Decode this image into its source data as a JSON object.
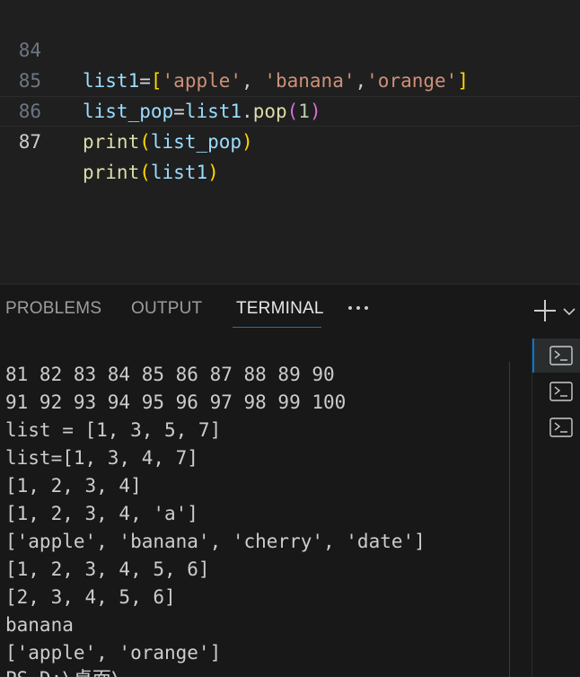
{
  "editor": {
    "lines": [
      {
        "number": "84",
        "tokens": [
          {
            "t": "list1",
            "c": "var"
          },
          {
            "t": "=",
            "c": "op"
          },
          {
            "t": "[",
            "c": "br1"
          },
          {
            "t": "'apple'",
            "c": "str"
          },
          {
            "t": ", ",
            "c": "punc"
          },
          {
            "t": "'banana'",
            "c": "str"
          },
          {
            "t": ",",
            "c": "punc"
          },
          {
            "t": "'orange'",
            "c": "str"
          },
          {
            "t": "]",
            "c": "br1"
          }
        ]
      },
      {
        "number": "85",
        "tokens": [
          {
            "t": "list_pop",
            "c": "var"
          },
          {
            "t": "=",
            "c": "op"
          },
          {
            "t": "list1",
            "c": "var"
          },
          {
            "t": ".",
            "c": "punc"
          },
          {
            "t": "pop",
            "c": "fn"
          },
          {
            "t": "(",
            "c": "br2"
          },
          {
            "t": "1",
            "c": "num"
          },
          {
            "t": ")",
            "c": "br2"
          }
        ]
      },
      {
        "number": "86",
        "tokens": [
          {
            "t": "print",
            "c": "fn"
          },
          {
            "t": "(",
            "c": "br1"
          },
          {
            "t": "list_pop",
            "c": "var"
          },
          {
            "t": ")",
            "c": "br1"
          }
        ]
      },
      {
        "number": "87",
        "tokens": [
          {
            "t": "print",
            "c": "fn"
          },
          {
            "t": "(",
            "c": "br1"
          },
          {
            "t": "list1",
            "c": "var"
          },
          {
            "t": ")",
            "c": "br1"
          }
        ]
      }
    ]
  },
  "panel": {
    "tabs": [
      {
        "label": "PROBLEMS",
        "active": false
      },
      {
        "label": "OUTPUT",
        "active": false
      },
      {
        "label": "TERMINAL",
        "active": true
      }
    ],
    "more_label": "···"
  },
  "terminal": {
    "lines": [
      "81 82 83 84 85 86 87 88 89 90",
      "91 92 93 94 95 96 97 98 99 100",
      "list = [1, 3, 5, 7]",
      "list=[1, 3, 4, 7]",
      "[1, 2, 3, 4]",
      "[1, 2, 3, 4, 'a']",
      "['apple', 'banana', 'cherry', 'date']",
      "[1, 2, 3, 4, 5, 6]",
      "[2, 3, 4, 5, 6]",
      "banana",
      "['apple', 'orange']",
      "PS D:\\桌面\\"
    ],
    "sessions": [
      {
        "icon": "terminal-icon",
        "active": true
      },
      {
        "icon": "terminal-icon",
        "active": false
      },
      {
        "icon": "terminal-icon",
        "active": false
      }
    ]
  },
  "colors": {
    "accent": "#0078d4",
    "editor_bg": "#1f1f1f",
    "panel_bg": "#181818",
    "string": "#ce9178",
    "variable": "#9cdcfe",
    "function": "#dcdcaa",
    "bracket_gold": "#ffd700",
    "bracket_purple": "#da70d6",
    "number": "#b5cea8"
  }
}
